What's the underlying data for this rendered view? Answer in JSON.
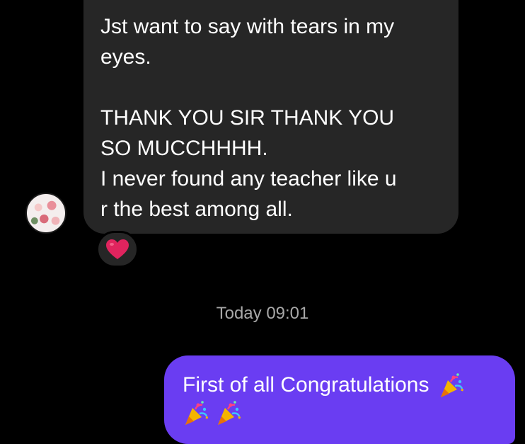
{
  "incoming": {
    "paragraph1": [
      "Jst want to say with tears in my",
      "eyes."
    ],
    "paragraph2": [
      "THANK YOU SIR THANK YOU",
      "SO MUCCHHHH.",
      "I never found any teacher like u",
      "r the best among all."
    ],
    "reaction": "heart-icon"
  },
  "timestamp": "Today 09:01",
  "outgoing": {
    "text": "First of all Congratulations",
    "emoji": "party-popper-icon"
  },
  "colors": {
    "background": "#000000",
    "incoming_bubble": "#262626",
    "outgoing_bubble": "#6a3df2",
    "timestamp": "#a8a8a8",
    "heart": "#e0245e"
  }
}
